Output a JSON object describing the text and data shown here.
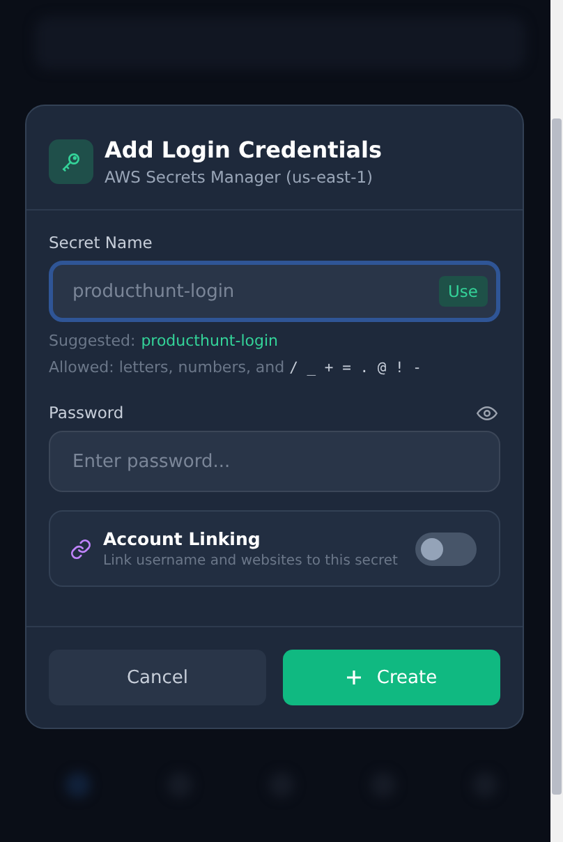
{
  "dialog": {
    "title": "Add Login Credentials",
    "subtitle": "AWS Secrets Manager (us-east-1)"
  },
  "secret_name": {
    "label": "Secret Name",
    "placeholder": "producthunt-login",
    "focused": true,
    "use_button": "Use"
  },
  "suggestion": {
    "label": "Suggested:",
    "value": "producthunt-login"
  },
  "allowed": {
    "text": "Allowed: letters, numbers, and",
    "chars": "/ _ + = . @ ! -"
  },
  "password": {
    "label": "Password",
    "placeholder": "Enter password..."
  },
  "account_linking": {
    "title": "Account Linking",
    "description": "Link username and websites to this secret",
    "on": false
  },
  "buttons": {
    "cancel": "Cancel",
    "create": "Create"
  }
}
